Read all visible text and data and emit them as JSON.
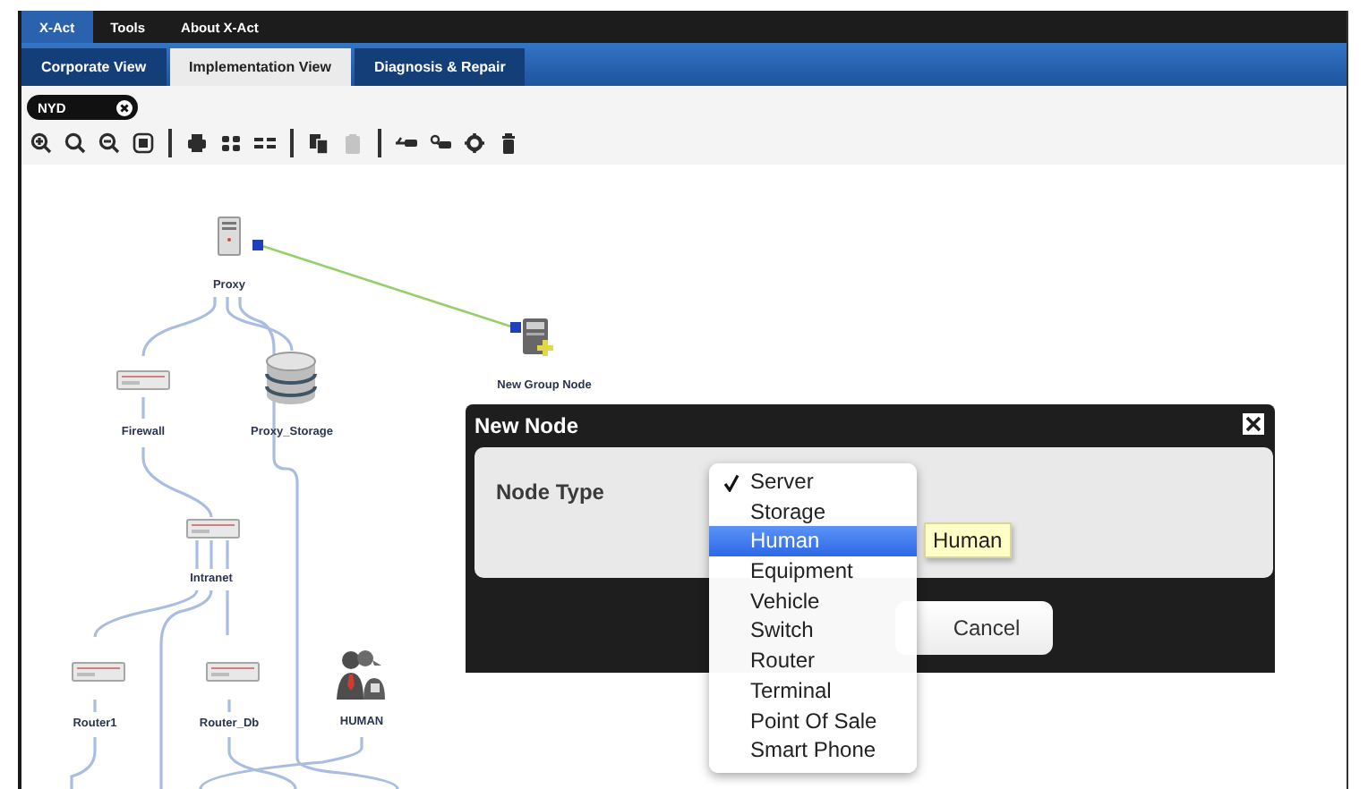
{
  "menu_bar": [
    {
      "label": "X-Act",
      "selected": true
    },
    {
      "label": "Tools",
      "selected": false
    },
    {
      "label": "About X-Act",
      "selected": false
    }
  ],
  "tabs": [
    {
      "label": "Corporate View",
      "selected": false
    },
    {
      "label": "Implementation View",
      "selected": true
    },
    {
      "label": "Diagnosis & Repair",
      "selected": false
    }
  ],
  "filter_chip": {
    "label": "NYD"
  },
  "toolbar": [
    {
      "kind": "zoom-in",
      "disabled": false
    },
    {
      "kind": "search",
      "disabled": false
    },
    {
      "kind": "zoom-out",
      "disabled": false
    },
    {
      "kind": "fit",
      "disabled": false
    },
    {
      "kind": "separator"
    },
    {
      "kind": "print",
      "disabled": false
    },
    {
      "kind": "grid",
      "disabled": false
    },
    {
      "kind": "list",
      "disabled": false
    },
    {
      "kind": "separator"
    },
    {
      "kind": "copy",
      "disabled": false
    },
    {
      "kind": "paste",
      "disabled": true
    },
    {
      "kind": "separator"
    },
    {
      "kind": "link-in",
      "disabled": false
    },
    {
      "kind": "link-node",
      "disabled": false
    },
    {
      "kind": "gear",
      "disabled": false
    },
    {
      "kind": "trash",
      "disabled": false
    }
  ],
  "diagram": {
    "nodes": [
      {
        "label": "Proxy",
        "kind": "server"
      },
      {
        "label": "New Group Node",
        "kind": "group"
      },
      {
        "label": "Firewall",
        "kind": "appliance"
      },
      {
        "label": "Proxy_Storage",
        "kind": "storage"
      },
      {
        "label": "Intranet",
        "kind": "appliance"
      },
      {
        "label": "Router1",
        "kind": "appliance"
      },
      {
        "label": "Router_Db",
        "kind": "appliance"
      },
      {
        "label": "HUMAN",
        "kind": "human"
      }
    ]
  },
  "dialog": {
    "title": "New Node",
    "field_label": "Node Type",
    "buttons": [
      "Cancel"
    ]
  },
  "dropdown": {
    "options": [
      {
        "label": "Server",
        "selected": true,
        "highlighted": false
      },
      {
        "label": "Storage",
        "selected": false,
        "highlighted": false
      },
      {
        "label": "Human",
        "selected": false,
        "highlighted": true
      },
      {
        "label": "Equipment",
        "selected": false,
        "highlighted": false
      },
      {
        "label": "Vehicle",
        "selected": false,
        "highlighted": false
      },
      {
        "label": "Switch",
        "selected": false,
        "highlighted": false
      },
      {
        "label": "Router",
        "selected": false,
        "highlighted": false
      },
      {
        "label": "Terminal",
        "selected": false,
        "highlighted": false
      },
      {
        "label": "Point Of Sale",
        "selected": false,
        "highlighted": false
      },
      {
        "label": "Smart Phone",
        "selected": false,
        "highlighted": false
      }
    ]
  },
  "tooltip": {
    "text": "Human"
  }
}
